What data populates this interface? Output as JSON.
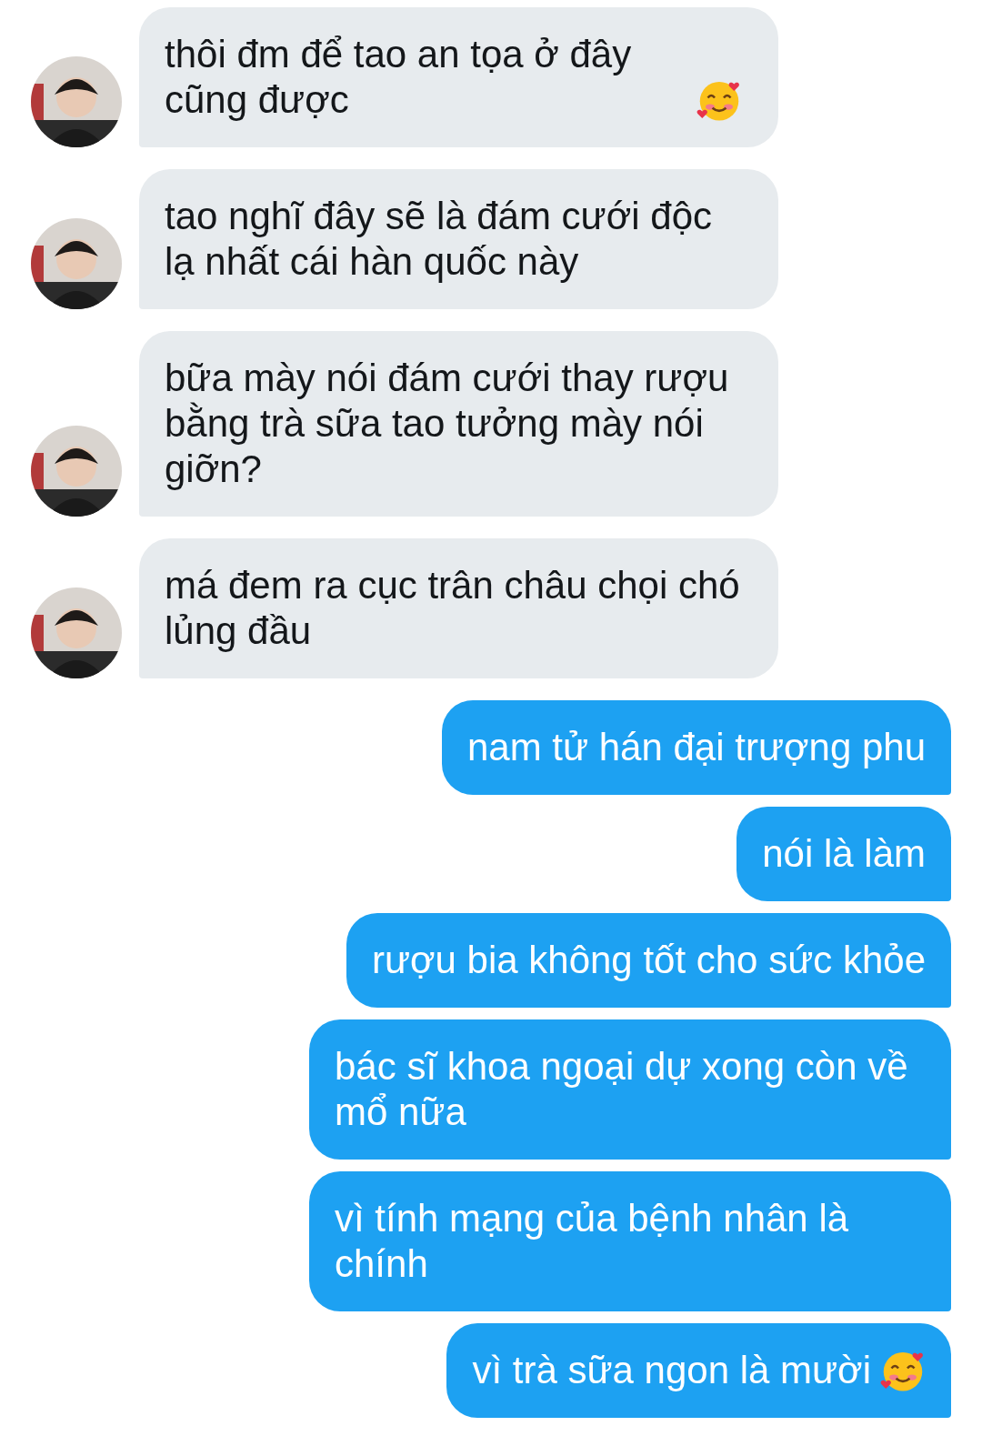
{
  "messages": [
    {
      "kind": "received",
      "text": "thôi đm để tao an tọa ở đây cũng được",
      "emoji": true
    },
    {
      "kind": "received",
      "text": "tao nghĩ đây sẽ là đám cưới độc lạ nhất cái hàn quốc này",
      "emoji": false
    },
    {
      "kind": "received",
      "text": "bữa mày nói đám cưới thay rượu bằng trà sữa tao tưởng mày nói giỡn?",
      "emoji": false
    },
    {
      "kind": "received",
      "text": "má đem ra cục trân châu chọi chó lủng đầu",
      "emoji": false
    },
    {
      "kind": "sent",
      "text": "nam tử hán đại trượng phu",
      "emoji": false
    },
    {
      "kind": "sent",
      "text": "nói là làm",
      "emoji": false
    },
    {
      "kind": "sent",
      "text": "rượu bia không tốt cho sức khỏe",
      "emoji": false
    },
    {
      "kind": "sent",
      "text": "bác sĩ khoa ngoại dự xong còn về mổ nữa",
      "emoji": false
    },
    {
      "kind": "sent",
      "text": "vì tính mạng của bệnh nhân là chính",
      "emoji": false
    },
    {
      "kind": "sent",
      "text": "vì trà sữa ngon là mười",
      "emoji": true
    }
  ]
}
